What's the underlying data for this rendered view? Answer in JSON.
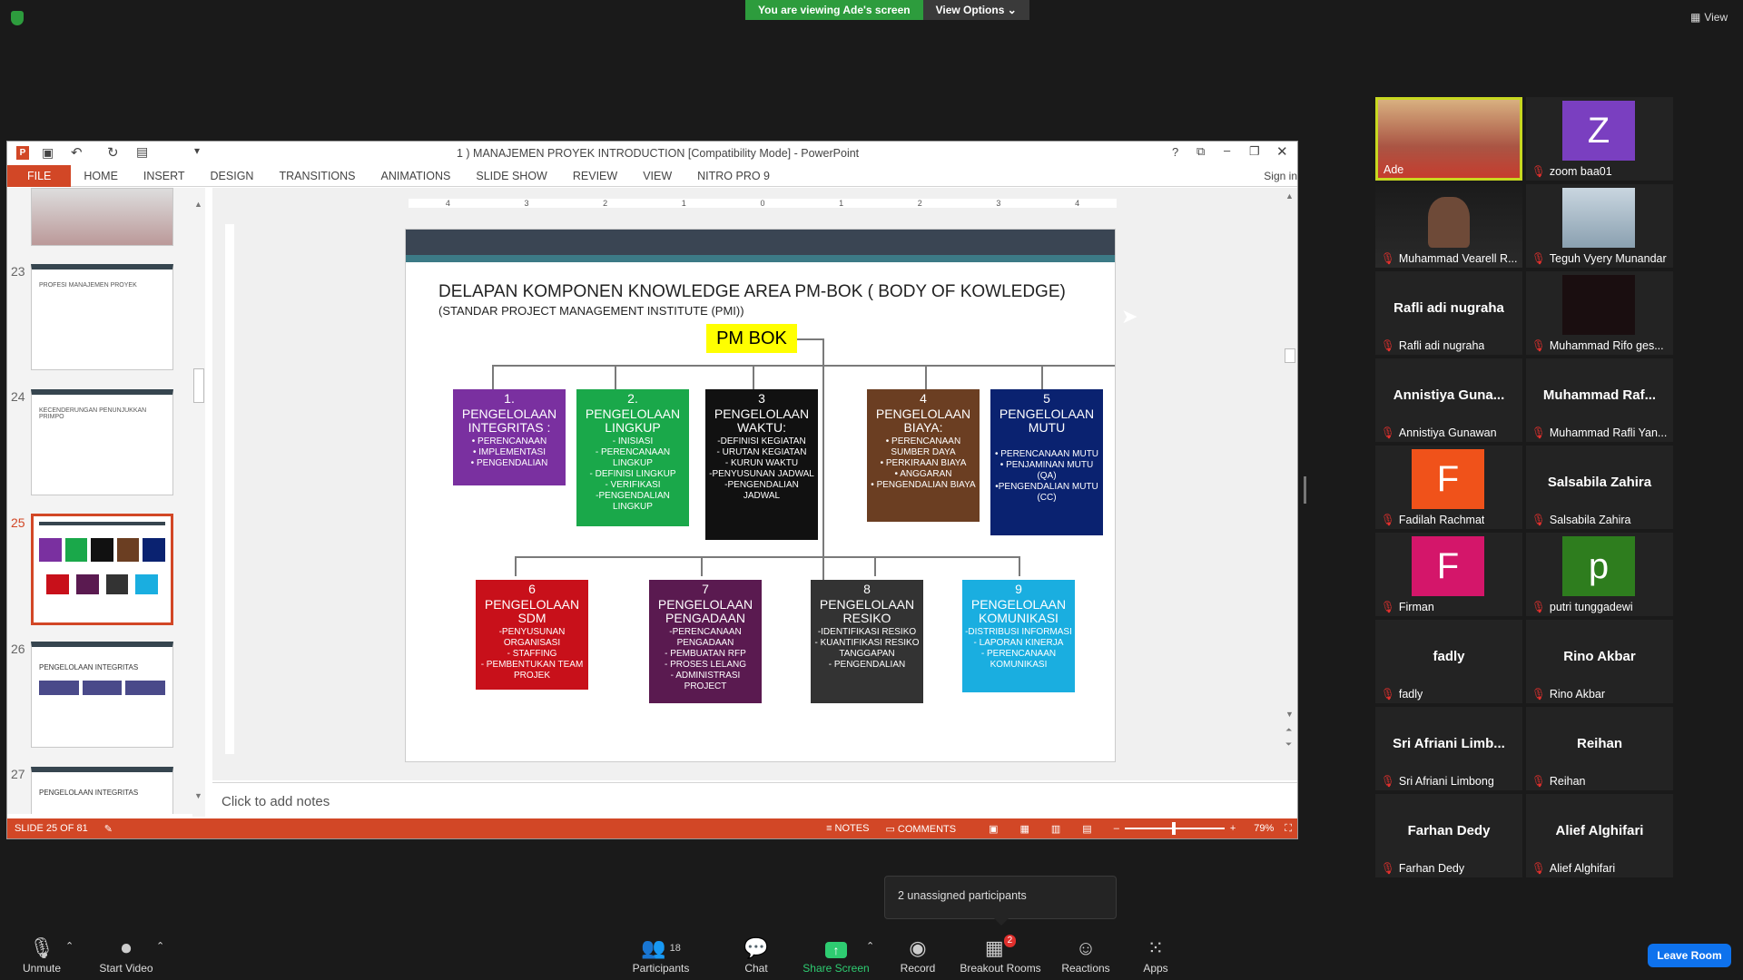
{
  "zoom": {
    "viewing_banner": "You are viewing Ade's screen",
    "view_options": "View Options",
    "view_btn": "View",
    "unassigned": "2 unassigned participants",
    "leave": "Leave Room"
  },
  "ppt": {
    "title": "1 ) MANAJEMEN PROYEK INTRODUCTION [Compatibility Mode] - PowerPoint",
    "sign_in": "Sign in",
    "tabs": [
      "FILE",
      "HOME",
      "INSERT",
      "DESIGN",
      "TRANSITIONS",
      "ANIMATIONS",
      "SLIDE SHOW",
      "REVIEW",
      "VIEW",
      "NITRO PRO 9"
    ],
    "status": {
      "slide": "SLIDE 25 OF 81",
      "notes": "NOTES",
      "comments": "COMMENTS",
      "zoom": "79%"
    },
    "notes_placeholder": "Click to add notes",
    "thumbs": [
      {
        "num": "23",
        "title": "PROFESI MANAJEMEN PROYEK"
      },
      {
        "num": "24",
        "title": "KECENDERUNGAN PENUNJUKKAN PRIMPO"
      },
      {
        "num": "25",
        "title": ""
      },
      {
        "num": "26",
        "title": "PENGELOLAAN INTEGRITAS"
      },
      {
        "num": "27",
        "title": "PENGELOLAAN INTEGRITAS"
      }
    ],
    "ruler": [
      "4",
      "3",
      "2",
      "1",
      "0",
      "1",
      "2",
      "3",
      "4"
    ]
  },
  "slide": {
    "title": "DELAPAN KOMPONEN KNOWLEDGE AREA PM-BOK ( BODY OF KOWLEDGE)",
    "subtitle": "(STANDAR  PROJECT MANAGEMENT INSTITUTE (PMI))",
    "root": "PM BOK",
    "boxes": [
      {
        "n": "1.",
        "h": "PENGELOLAAN INTEGRITAS :",
        "b": "• PERENCANAAN\n• IMPLEMENTASI\n• PENGENDALIAN",
        "c": "#7a30a0"
      },
      {
        "n": "2.",
        "h": "PENGELOLAAN LINGKUP",
        "b": "- INISIASI\n- PERENCANAAN LINGKUP\n- DEFINISI LINGKUP\n- VERIFIKASI\n-PENGENDALIAN LINGKUP",
        "c": "#1aa84a"
      },
      {
        "n": "3",
        "h": "PENGELOLAAN WAKTU:",
        "b": "-DEFINISI KEGIATAN\n- URUTAN KEGIATAN\n- KURUN WAKTU\n-PENYUSUNAN JADWAL\n-PENGENDALIAN JADWAL",
        "c": "#111111"
      },
      {
        "n": "4",
        "h": "PENGELOLAAN BIAYA:",
        "b": "• PERENCANAAN SUMBER DAYA\n• PERKIRAAN BIAYA\n• ANGGARAN\n• PENGENDALIAN BIAYA",
        "c": "#6b3e22"
      },
      {
        "n": "5",
        "h": "PENGELOLAAN MUTU",
        "b": "• PERENCANAAN MUTU\n• PENJAMINAN MUTU (QA)\n•PENGENDALIAN MUTU (CC)",
        "c": "#0a2270"
      },
      {
        "n": "6",
        "h": "PENGELOLAAN SDM",
        "b": "-PENYUSUNAN ORGANISASI\n- STAFFING\n- PEMBENTUKAN TEAM PROJEK",
        "c": "#c8101a"
      },
      {
        "n": "7",
        "h": "PENGELOLAAN PENGADAAN",
        "b": "-PERENCANAAN PENGADAAN\n- PEMBUATAN RFP\n- PROSES LELANG\n- ADMINISTRASI PROJECT",
        "c": "#5a1a50"
      },
      {
        "n": "8",
        "h": "PENGELOLAAN RESIKO",
        "b": "-IDENTIFIKASI RESIKO\n- KUANTIFIKASI RESIKO TANGGAPAN\n- PENGENDALIAN",
        "c": "#333333"
      },
      {
        "n": "9",
        "h": "PENGELOLAAN KOMUNIKASI",
        "b": "-DISTRIBUSI INFORMASI\n- LAPORAN KINERJA\n- PERENCANAAN KOMUNIKASI",
        "c": "#1aaee0"
      }
    ]
  },
  "participants": [
    {
      "name": "Ade",
      "big": "",
      "av": "",
      "avc": "",
      "video": true
    },
    {
      "name": "zoom baa01",
      "big": "",
      "av": "Z",
      "avc": "#7a3fc0",
      "video": false
    },
    {
      "name": "Muhammad Vearell R...",
      "big": "",
      "av": "",
      "avc": "",
      "video": true
    },
    {
      "name": "Teguh Vyery Munandar",
      "big": "",
      "av": "",
      "avc": "",
      "video": true
    },
    {
      "name": "Rafli adi nugraha",
      "big": "Rafli adi nugraha",
      "av": "",
      "avc": "",
      "video": false
    },
    {
      "name": "Muhammad Rifo ges...",
      "big": "",
      "av": "",
      "avc": "",
      "video": true
    },
    {
      "name": "Annistiya Gunawan",
      "big": "Annistiya Guna...",
      "av": "",
      "avc": "",
      "video": false
    },
    {
      "name": "Muhammad Rafli Yan...",
      "big": "Muhammad Raf...",
      "av": "",
      "avc": "",
      "video": false
    },
    {
      "name": "Fadilah Rachmat",
      "big": "",
      "av": "F",
      "avc": "#f0521a",
      "video": false
    },
    {
      "name": "Salsabila Zahira",
      "big": "Salsabila Zahira",
      "av": "",
      "avc": "",
      "video": false
    },
    {
      "name": "Firman",
      "big": "",
      "av": "F",
      "avc": "#d4166a",
      "video": false
    },
    {
      "name": "putri tunggadewi",
      "big": "",
      "av": "p",
      "avc": "#2e7d1e",
      "video": false
    },
    {
      "name": "fadly",
      "big": "fadly",
      "av": "",
      "avc": "",
      "video": false
    },
    {
      "name": "Rino Akbar",
      "big": "Rino Akbar",
      "av": "",
      "avc": "",
      "video": false
    },
    {
      "name": "Sri Afriani Limbong",
      "big": "Sri Afriani Limb...",
      "av": "",
      "avc": "",
      "video": false
    },
    {
      "name": "Reihan",
      "big": "Reihan",
      "av": "",
      "avc": "",
      "video": false
    },
    {
      "name": "Farhan Dedy",
      "big": "Farhan Dedy",
      "av": "",
      "avc": "",
      "video": false
    },
    {
      "name": "Alief Alghifari",
      "big": "Alief Alghifari",
      "av": "",
      "avc": "",
      "video": false
    }
  ],
  "toolbar": {
    "unmute": "Unmute",
    "start_video": "Start Video",
    "participants": "Participants",
    "participants_count": "18",
    "chat": "Chat",
    "share": "Share Screen",
    "record": "Record",
    "breakout": "Breakout Rooms",
    "breakout_badge": "2",
    "reactions": "Reactions",
    "apps": "Apps"
  }
}
